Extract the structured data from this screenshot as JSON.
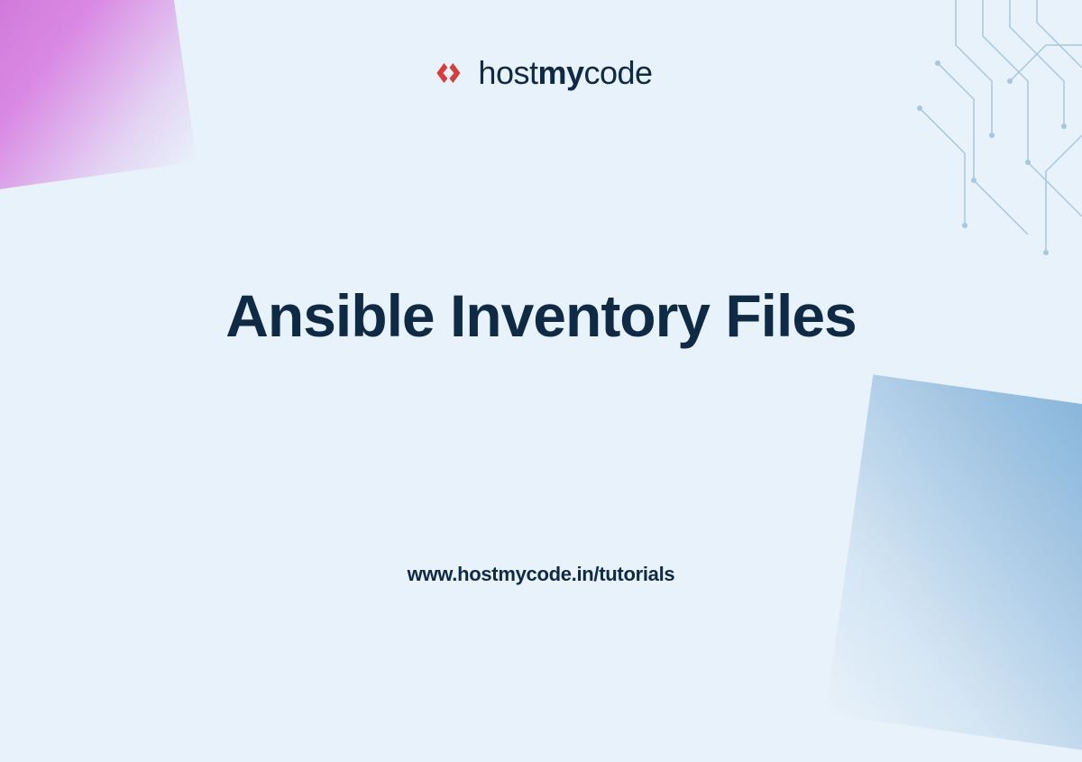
{
  "logo": {
    "prefix": "host",
    "bold": "my",
    "suffix": "code",
    "icon_name": "double-arrow-logo"
  },
  "title": "Ansible Inventory Files",
  "footer_url": "www.hostmycode.in/tutorials",
  "colors": {
    "background": "#e8f2fa",
    "text_dark": "#0f2a44",
    "accent_red": "#d63d3d",
    "magenta": "#c765d3",
    "blue": "#6fa8d6"
  }
}
